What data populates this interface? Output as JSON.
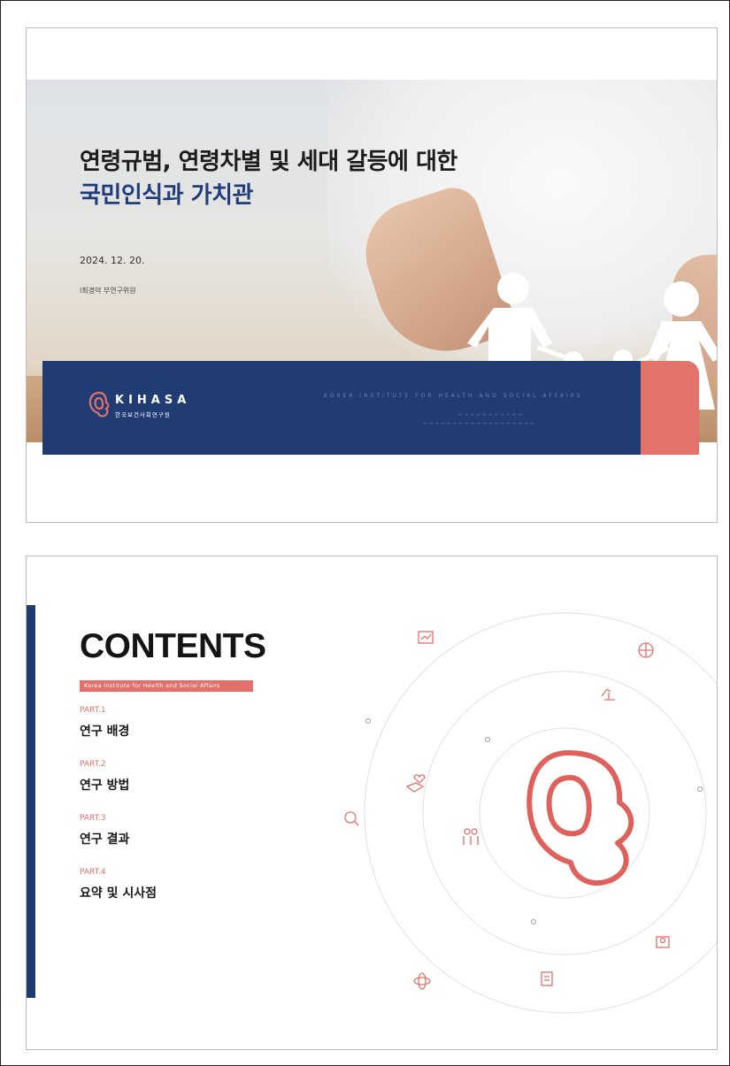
{
  "slide1": {
    "title_line1": "연령규범, 연령차별 및 세대 갈등에 대한",
    "title_line2": "국민인식과 가치관",
    "date": "2024. 12. 20.",
    "author": "l최경덕 부연구위원",
    "logo_text": "KIHASA",
    "logo_sub": "한국보건사회연구원",
    "band_english": "KOREA INSTITUTE FOR HEALTH AND SOCIAL AFFAIRS",
    "colors": {
      "navy": "#203c72",
      "coral": "#e2726a"
    }
  },
  "slide2": {
    "heading": "CONTENTS",
    "subheading": "Korea Institute for Health and Social Affairs",
    "parts": [
      {
        "label": "PART.1",
        "title": "연구 배경"
      },
      {
        "label": "PART.2",
        "title": "연구 방법"
      },
      {
        "label": "PART.3",
        "title": "연구 결과"
      },
      {
        "label": "PART.4",
        "title": "요약 및 시사점"
      }
    ],
    "icons": [
      "chart-board-icon",
      "globe-icon",
      "microscope-icon",
      "hand-heart-icon",
      "search-chart-icon",
      "family-icon",
      "people-icon",
      "atom-icon",
      "clipboard-icon"
    ],
    "colors": {
      "navy": "#1f3b70",
      "coral": "#e0716b"
    }
  }
}
